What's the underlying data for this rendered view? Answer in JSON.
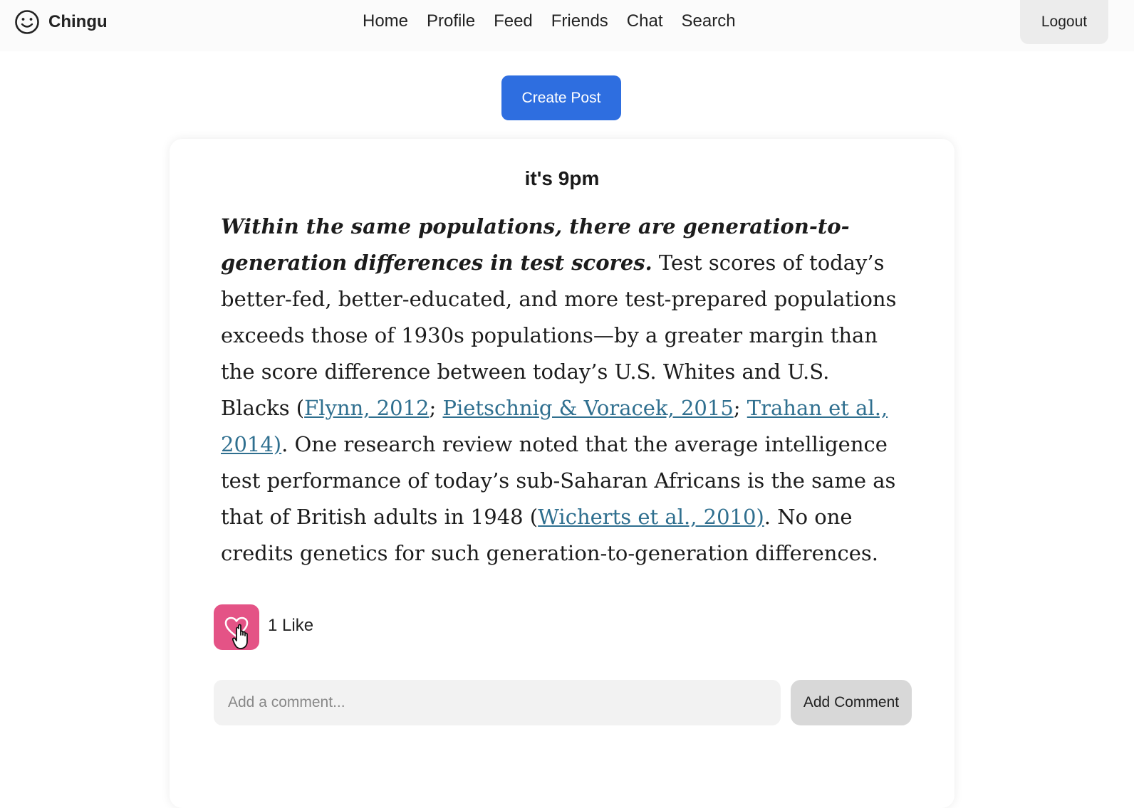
{
  "header": {
    "brand": "Chingu",
    "nav": [
      "Home",
      "Profile",
      "Feed",
      "Friends",
      "Chat",
      "Search"
    ],
    "logout_label": "Logout"
  },
  "create_post_label": "Create Post",
  "post": {
    "title": "it's 9pm",
    "body": {
      "lead": "Within the same populations, there are generation-to-generation differences in test scores.",
      "text_1": " Test scores of today’s better-fed, better-educated, and more test-prepared populations exceeds those of 1930s populations—by a greater margin than the score difference between today’s U.S. Whites and U.S. Blacks (",
      "link_1": "Flynn, 2012",
      "sep_1": "; ",
      "link_2": "Pietschnig & Voracek, 2015",
      "sep_2": "; ",
      "link_3": "Trahan et al., 2014)",
      "text_2": ". One research review noted that the average intelligence test performance of today’s sub-Saharan Africans is the same as that of British adults in 1948 (",
      "link_4": "Wicherts et al., 2010)",
      "text_3": ". No one credits genetics for such generation-to-generation differences."
    },
    "like_count_label": "1 Like",
    "comment_placeholder": "Add a comment...",
    "add_comment_label": "Add Comment"
  },
  "colors": {
    "primary": "#2e6ee0",
    "like": "#e45386",
    "link": "#2f6f8f"
  },
  "icons": {
    "brand": "smiley-icon",
    "like": "heart-icon",
    "cursor": "hand-pointer-icon"
  }
}
